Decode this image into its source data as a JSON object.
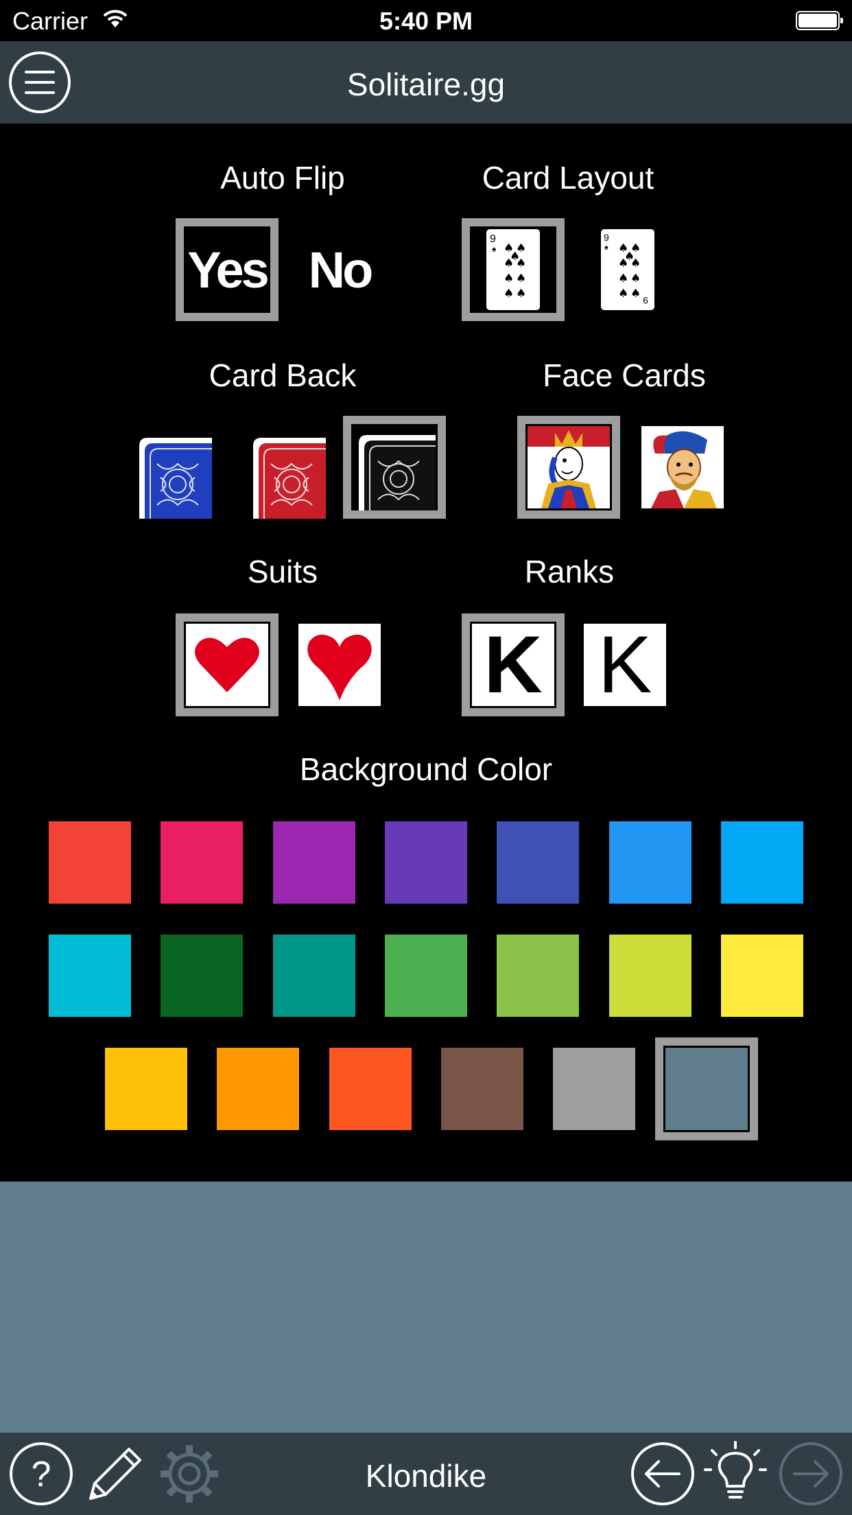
{
  "status": {
    "carrier": "Carrier",
    "time": "5:40 PM"
  },
  "header": {
    "title": "Solitaire.gg",
    "menu_icon": "hamburger-menu-icon"
  },
  "settings": {
    "auto_flip": {
      "label": "Auto Flip",
      "options": [
        "Yes",
        "No"
      ],
      "selected": "Yes"
    },
    "card_layout": {
      "label": "Card Layout",
      "rank": "9",
      "selected_index": 0
    },
    "card_back": {
      "label": "Card Back",
      "colors": [
        "#1f3fbf",
        "#c81f2a",
        "#111111"
      ],
      "selected_index": 2
    },
    "face_cards": {
      "label": "Face Cards",
      "selected_index": 0
    },
    "suits": {
      "label": "Suits",
      "selected_index": 0,
      "color": "#e0001b"
    },
    "ranks": {
      "label": "Ranks",
      "rank": "K",
      "selected_index": 0
    },
    "background_color": {
      "label": "Background Color",
      "rows": [
        [
          "#f44336",
          "#e91e63",
          "#9c27b0",
          "#673ab7",
          "#3f51b5",
          "#2196f3",
          "#03a9f4"
        ],
        [
          "#00bcd4",
          "#0a6524",
          "#009688",
          "#4caf50",
          "#8bc34a",
          "#cddc39",
          "#ffeb3b"
        ],
        [
          "#ffc107",
          "#ff9800",
          "#ff5722",
          "#795548",
          "#9e9e9e",
          "#607d8b"
        ]
      ],
      "selected": "#607d8b"
    }
  },
  "toolbar": {
    "title": "Klondike",
    "icons": [
      "help-icon",
      "pencil-icon",
      "gear-icon",
      "undo-icon",
      "hint-icon",
      "redo-icon"
    ]
  }
}
